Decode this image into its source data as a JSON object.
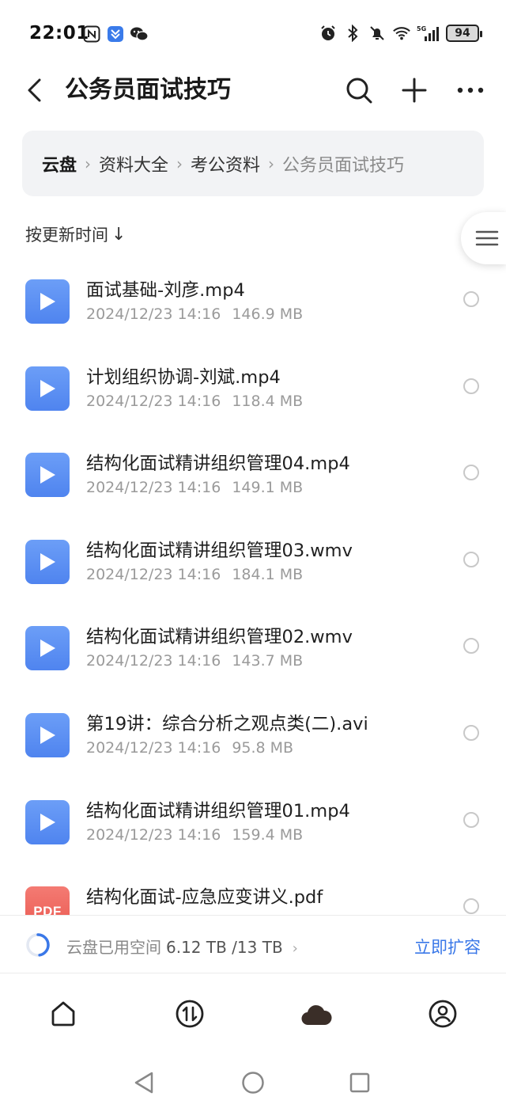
{
  "status": {
    "time": "22:01",
    "battery": "94",
    "left_icons": [
      "nfc-icon",
      "app-notify-icon",
      "wechat-icon"
    ],
    "right_icons": [
      "alarm-icon",
      "bluetooth-icon",
      "mute-icon",
      "wifi-icon",
      "signal-5g-icon",
      "battery-icon"
    ]
  },
  "header": {
    "title": "公务员面试技巧",
    "icons": [
      "back-icon",
      "search-icon",
      "plus-icon",
      "more-icon"
    ]
  },
  "breadcrumb": [
    "云盘",
    "资料大全",
    "考公资料",
    "公务员面试技巧"
  ],
  "sort": {
    "label": "按更新时间",
    "arrow": "↓"
  },
  "files": [
    {
      "name": "面试基础-刘彦.mp4",
      "date": "2024/12/23 14:16",
      "size": "146.9 MB",
      "type": "video"
    },
    {
      "name": "计划组织协调-刘斌.mp4",
      "date": "2024/12/23 14:16",
      "size": "118.4 MB",
      "type": "video"
    },
    {
      "name": "结构化面试精讲组织管理04.mp4",
      "date": "2024/12/23 14:16",
      "size": "149.1 MB",
      "type": "video"
    },
    {
      "name": "结构化面试精讲组织管理03.wmv",
      "date": "2024/12/23 14:16",
      "size": "184.1 MB",
      "type": "video"
    },
    {
      "name": "结构化面试精讲组织管理02.wmv",
      "date": "2024/12/23 14:16",
      "size": "143.7 MB",
      "type": "video"
    },
    {
      "name": "第19讲：综合分析之观点类(二).avi",
      "date": "2024/12/23 14:16",
      "size": "95.8 MB",
      "type": "video"
    },
    {
      "name": "结构化面试精讲组织管理01.mp4",
      "date": "2024/12/23 14:16",
      "size": "159.4 MB",
      "type": "video"
    },
    {
      "name": "结构化面试-应急应变讲义.pdf",
      "date": "",
      "size": "",
      "type": "pdf",
      "icon_text": "PDF"
    }
  ],
  "storage": {
    "label": "云盘已用空间",
    "value": "6.12 TB /13 TB",
    "used_fraction": 0.47,
    "expand": "立即扩容",
    "accent": "#3a78e8"
  },
  "bottom_nav": [
    "home-icon",
    "transfer-icon",
    "cloud-icon",
    "profile-icon"
  ],
  "system_nav": [
    "back-triangle-icon",
    "home-circle-icon",
    "recents-square-icon"
  ]
}
